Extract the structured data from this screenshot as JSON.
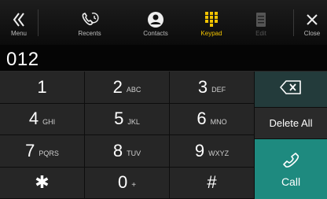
{
  "toolbar": {
    "menu_label": "Menu",
    "recents_label": "Recents",
    "contacts_label": "Contacts",
    "keypad_label": "Keypad",
    "edit_label": "Edit",
    "close_label": "Close",
    "active_tab": "Keypad",
    "accent_color": "#f3c400",
    "icons": [
      "double-chevron-left-icon",
      "recents-phone-icon",
      "contact-person-icon",
      "keypad-grid-icon",
      "edit-document-icon",
      "close-x-icon"
    ]
  },
  "display": {
    "number": "012"
  },
  "keypad": {
    "keys": [
      {
        "digit": "1",
        "letters": ""
      },
      {
        "digit": "2",
        "letters": "ABC"
      },
      {
        "digit": "3",
        "letters": "DEF"
      },
      {
        "digit": "4",
        "letters": "GHI"
      },
      {
        "digit": "5",
        "letters": "JKL"
      },
      {
        "digit": "6",
        "letters": "MNO"
      },
      {
        "digit": "7",
        "letters": "PQRS"
      },
      {
        "digit": "8",
        "letters": "TUV"
      },
      {
        "digit": "9",
        "letters": "WXYZ"
      },
      {
        "digit": "✱",
        "letters": ""
      },
      {
        "digit": "0",
        "letters": "+"
      },
      {
        "digit": "#",
        "letters": ""
      }
    ]
  },
  "actions": {
    "backspace_icon": "backspace-icon",
    "delete_all_label": "Delete All",
    "call_label": "Call",
    "call_color": "#1e8a7f"
  }
}
